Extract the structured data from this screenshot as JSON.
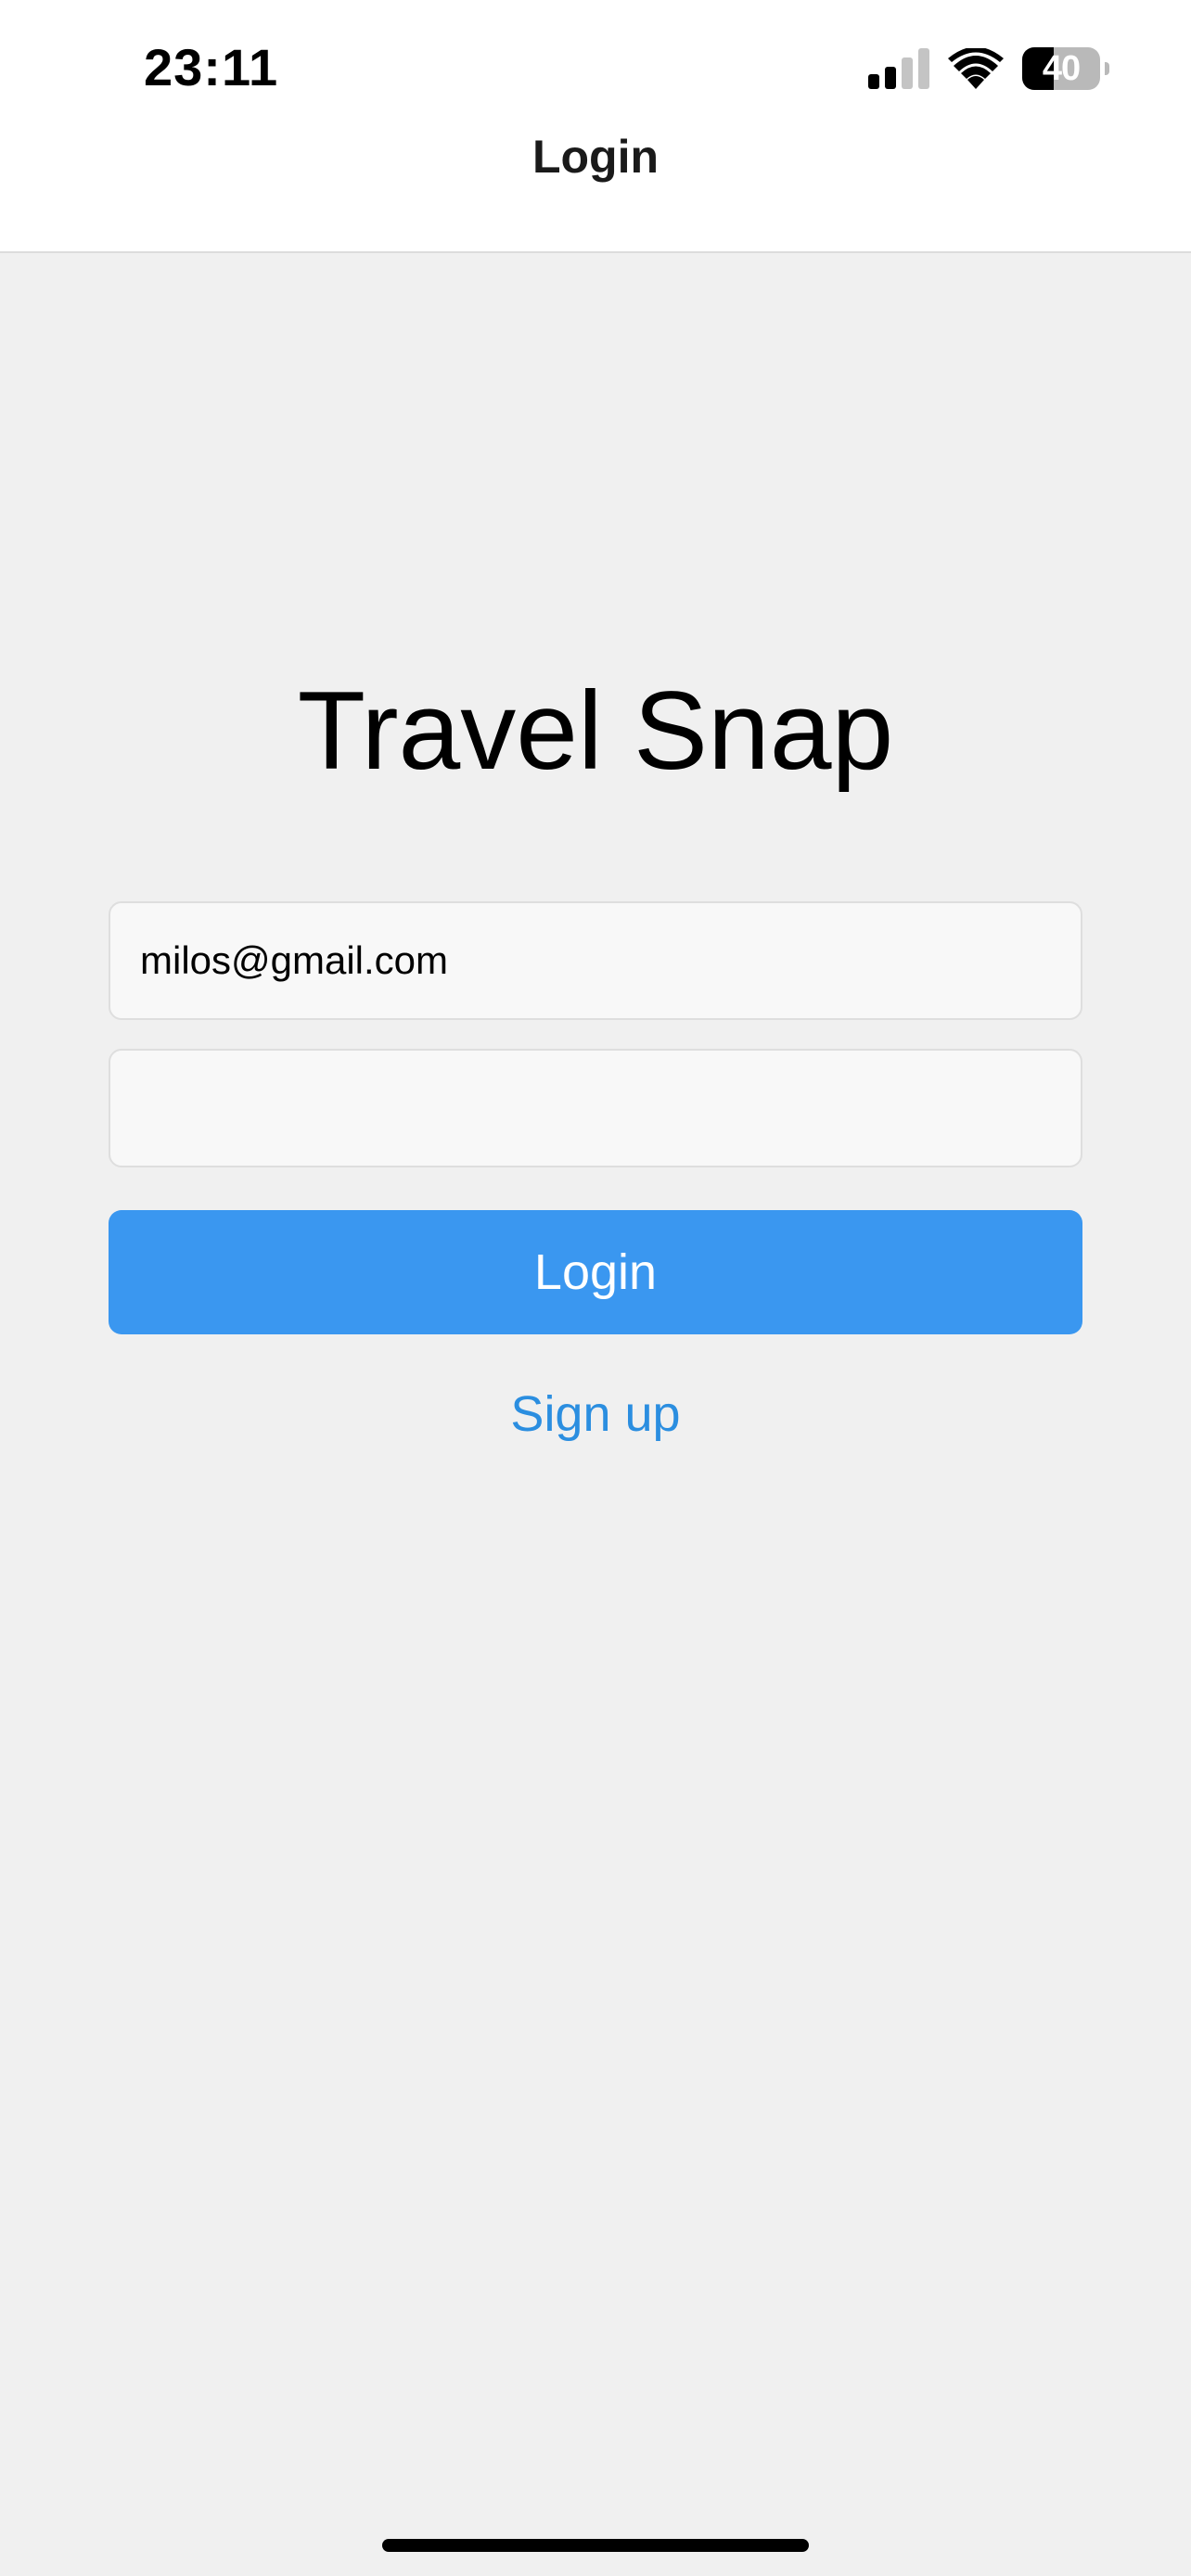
{
  "status_bar": {
    "time": "23:11",
    "battery_level": "40",
    "battery_fraction": 0.4,
    "signal_bars_active": 2,
    "signal_bars_total": 4
  },
  "nav": {
    "title": "Login"
  },
  "app": {
    "title": "Travel Snap"
  },
  "form": {
    "email_value": "milos@gmail.com",
    "password_value": "",
    "login_label": "Login",
    "signup_label": "Sign up"
  },
  "colors": {
    "primary": "#3a97f0",
    "link": "#2b8ee0",
    "background": "#f0f0f0",
    "field_bg": "#f8f8f8"
  },
  "icons": [
    "signal-icon",
    "wifi-icon",
    "battery-icon"
  ]
}
